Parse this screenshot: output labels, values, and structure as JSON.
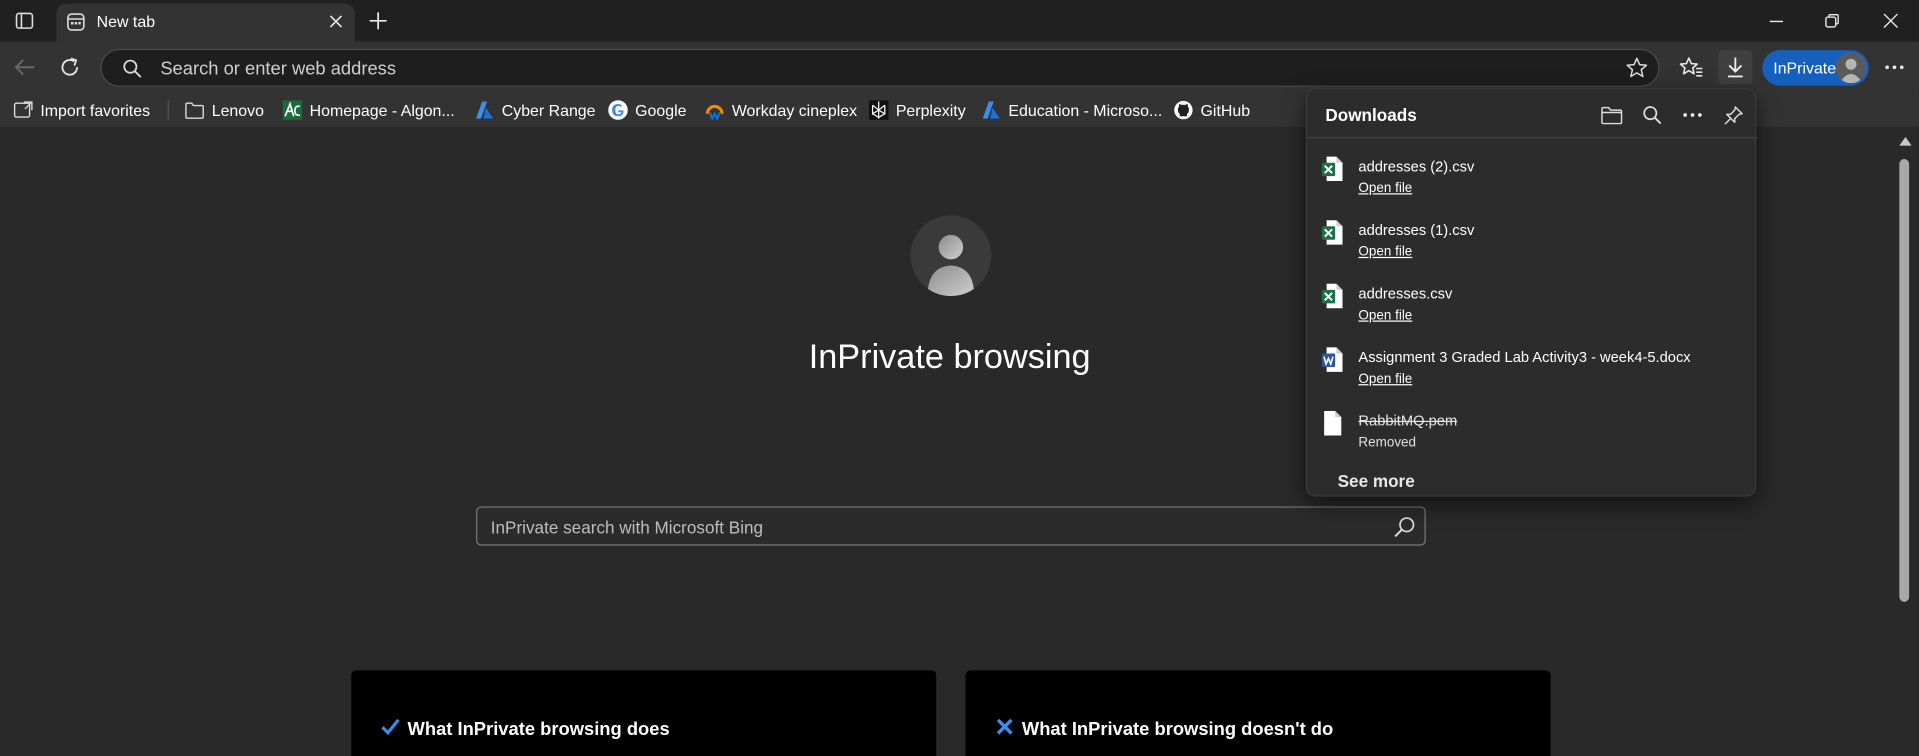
{
  "browser": {
    "tab": {
      "title": "New tab"
    },
    "address_bar": {
      "placeholder": "Search or enter web address"
    },
    "inprivate_label": "InPrivate"
  },
  "favorites": [
    {
      "label": "Import favorites",
      "icon": "import-favorites-icon"
    },
    {
      "label": "Lenovo",
      "icon": "folder-icon"
    },
    {
      "label": "Homepage - Algon...",
      "icon": "algonquin-icon"
    },
    {
      "label": "Cyber Range",
      "icon": "cyber-range-icon"
    },
    {
      "label": "Google",
      "icon": "google-icon"
    },
    {
      "label": "Workday cineplex",
      "icon": "workday-icon"
    },
    {
      "label": "Perplexity",
      "icon": "perplexity-icon"
    },
    {
      "label": "Education - Microso...",
      "icon": "azure-icon"
    },
    {
      "label": "GitHub",
      "icon": "github-icon"
    }
  ],
  "page": {
    "title": "InPrivate browsing",
    "search_placeholder": "InPrivate search with Microsoft Bing",
    "cards": [
      {
        "title": "What InPrivate browsing does",
        "icon": "checkmark-icon"
      },
      {
        "title": "What InPrivate browsing doesn't do",
        "icon": "x-icon"
      }
    ]
  },
  "downloads": {
    "title": "Downloads",
    "items": [
      {
        "name": "addresses (2).csv",
        "action": "Open file",
        "type": "excel"
      },
      {
        "name": "addresses (1).csv",
        "action": "Open file",
        "type": "excel"
      },
      {
        "name": "addresses.csv",
        "action": "Open file",
        "type": "excel"
      },
      {
        "name": "Assignment 3 Graded Lab Activity3 - week4-5.docx",
        "action": "Open file",
        "type": "word"
      },
      {
        "name": "RabbitMQ.pem",
        "status": "Removed",
        "type": "generic"
      }
    ],
    "see_more": "See more"
  },
  "colors": {
    "accent": "#1560bd",
    "excel": "#1e7145",
    "word": "#2b579a"
  }
}
